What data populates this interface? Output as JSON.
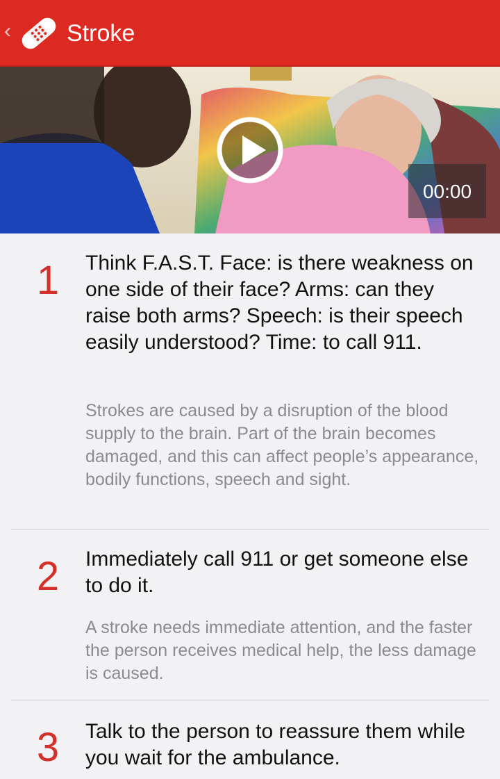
{
  "appbar": {
    "title": "Stroke",
    "back_icon": "chevron-left-icon",
    "logo_icon": "bandage-icon",
    "color": "#dc2a23"
  },
  "video": {
    "time": "00:00",
    "play_icon": "play-icon"
  },
  "steps": [
    {
      "number": "1",
      "heading": "Think F.A.S.T. Face: is there weakness on one side of their face?  Arms: can they raise both arms?  Speech: is their speech easily understood?  Time: to call 911.",
      "description": "Strokes are caused by a disruption of the blood supply to the brain. Part of the brain becomes damaged, and this can affect people’s appearance, bodily functions, speech and sight."
    },
    {
      "number": "2",
      "heading": "Immediately call 911 or get someone else to do it.",
      "description": "A stroke needs immediate attention, and the faster the person receives medical help, the less damage is caused."
    },
    {
      "number": "3",
      "heading": "Talk to the person to reassure them while you wait for the ambulance.",
      "description": ""
    }
  ],
  "colors": {
    "accent": "#dc2a23",
    "number": "#d3302a",
    "background": "#f2f2f5"
  }
}
